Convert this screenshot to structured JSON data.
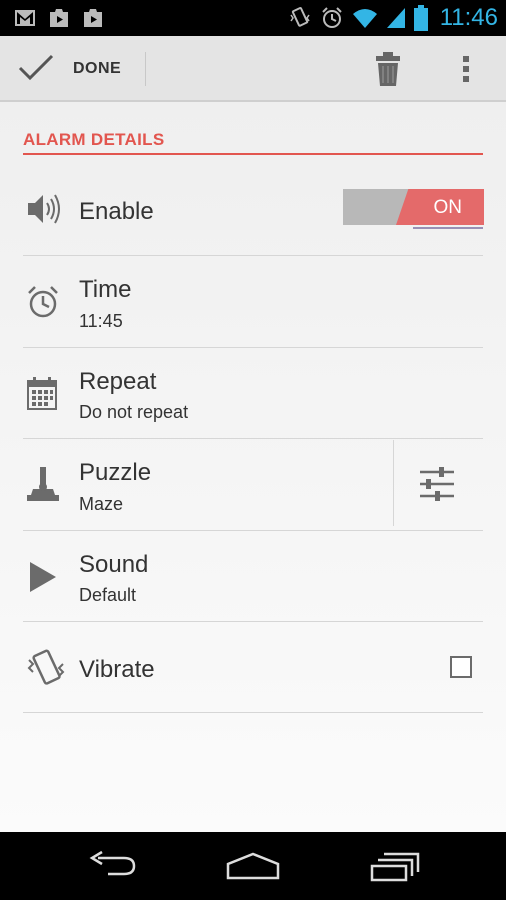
{
  "status_bar": {
    "time": "11:46",
    "left_icons": [
      "gmail-icon",
      "play-store-icon",
      "play-store-icon"
    ],
    "right_icons": [
      "vibrate-mode-icon",
      "alarm-icon",
      "wifi-icon",
      "signal-icon",
      "battery-icon"
    ],
    "accent_color": "#33b5e5"
  },
  "action_bar": {
    "done_label": "DONE",
    "actions": [
      "trash-icon",
      "overflow-menu-icon"
    ]
  },
  "section": {
    "header": "ALARM DETAILS",
    "accent_color": "#e2564f"
  },
  "settings": {
    "enable": {
      "title": "Enable",
      "toggle_state": "ON",
      "icon": "speaker-icon"
    },
    "time": {
      "title": "Time",
      "value": "11:45",
      "icon": "alarm-clock-icon"
    },
    "repeat": {
      "title": "Repeat",
      "value": "Do not repeat",
      "icon": "calendar-icon"
    },
    "puzzle": {
      "title": "Puzzle",
      "value": "Maze",
      "icon": "joystick-icon",
      "action_icon": "sliders-icon"
    },
    "sound": {
      "title": "Sound",
      "value": "Default",
      "icon": "play-icon"
    },
    "vibrate": {
      "title": "Vibrate",
      "checked": false,
      "icon": "vibrate-phone-icon"
    }
  },
  "nav_bar": {
    "buttons": [
      "back-icon",
      "home-icon",
      "recent-apps-icon"
    ]
  }
}
